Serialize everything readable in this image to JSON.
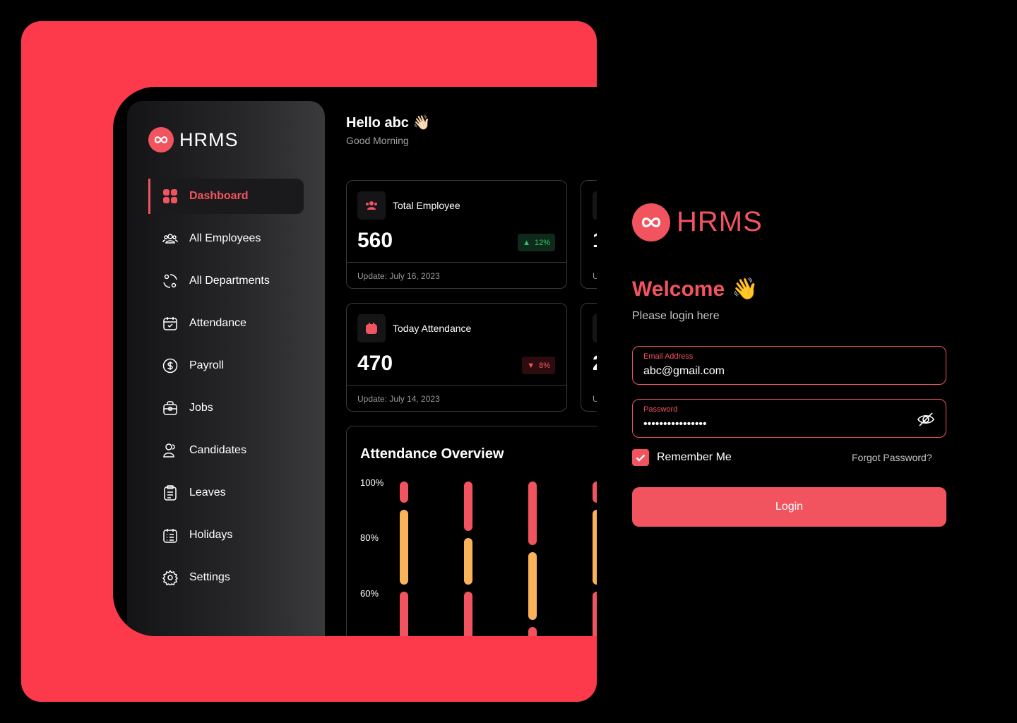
{
  "dashboard": {
    "brand": "HRMS",
    "nav": [
      {
        "label": "Dashboard",
        "icon": "dashboard-grid-icon",
        "active": true
      },
      {
        "label": "All Employees",
        "icon": "employees-icon"
      },
      {
        "label": "All Departments",
        "icon": "departments-icon"
      },
      {
        "label": "Attendance",
        "icon": "calendar-check-icon"
      },
      {
        "label": "Payroll",
        "icon": "dollar-circle-icon"
      },
      {
        "label": "Jobs",
        "icon": "briefcase-icon"
      },
      {
        "label": "Candidates",
        "icon": "candidates-icon"
      },
      {
        "label": "Leaves",
        "icon": "clipboard-icon"
      },
      {
        "label": "Holidays",
        "icon": "calendar-list-icon"
      },
      {
        "label": "Settings",
        "icon": "gear-icon"
      }
    ],
    "greeting": "Hello abc 👋🏻",
    "greeting_sub": "Good Morning",
    "stats": [
      {
        "label": "Total Employee",
        "value": "560",
        "change": "12%",
        "trend": "up",
        "update": "Update: July 16, 2023"
      },
      {
        "label": "Today Attendance",
        "value": "470",
        "change": "8%",
        "trend": "down",
        "update": "Update: July 14, 2023"
      }
    ],
    "stats_peek": [
      {
        "value": "1",
        "update": "U"
      },
      {
        "value": "2",
        "update": "U"
      }
    ],
    "overview": {
      "title": "Attendance Overview",
      "y_labels": [
        "100%",
        "80%",
        "60%"
      ]
    }
  },
  "login": {
    "brand": "HRMS",
    "welcome": "Welcome",
    "welcome_emoji": "👋",
    "subtitle": "Please login here",
    "email_label": "Email Address",
    "email_value": "abc@gmail.com",
    "password_label": "Password",
    "password_value": "••••••••••••••••",
    "remember_label": "Remember Me",
    "remember_checked": true,
    "forgot_label": "Forgot Password?",
    "login_label": "Login"
  },
  "colors": {
    "brand_red": "#fc3a4b",
    "accent": "#f2545f",
    "bar_yellow": "#fbb35a",
    "up_green": "#31c46a"
  }
}
